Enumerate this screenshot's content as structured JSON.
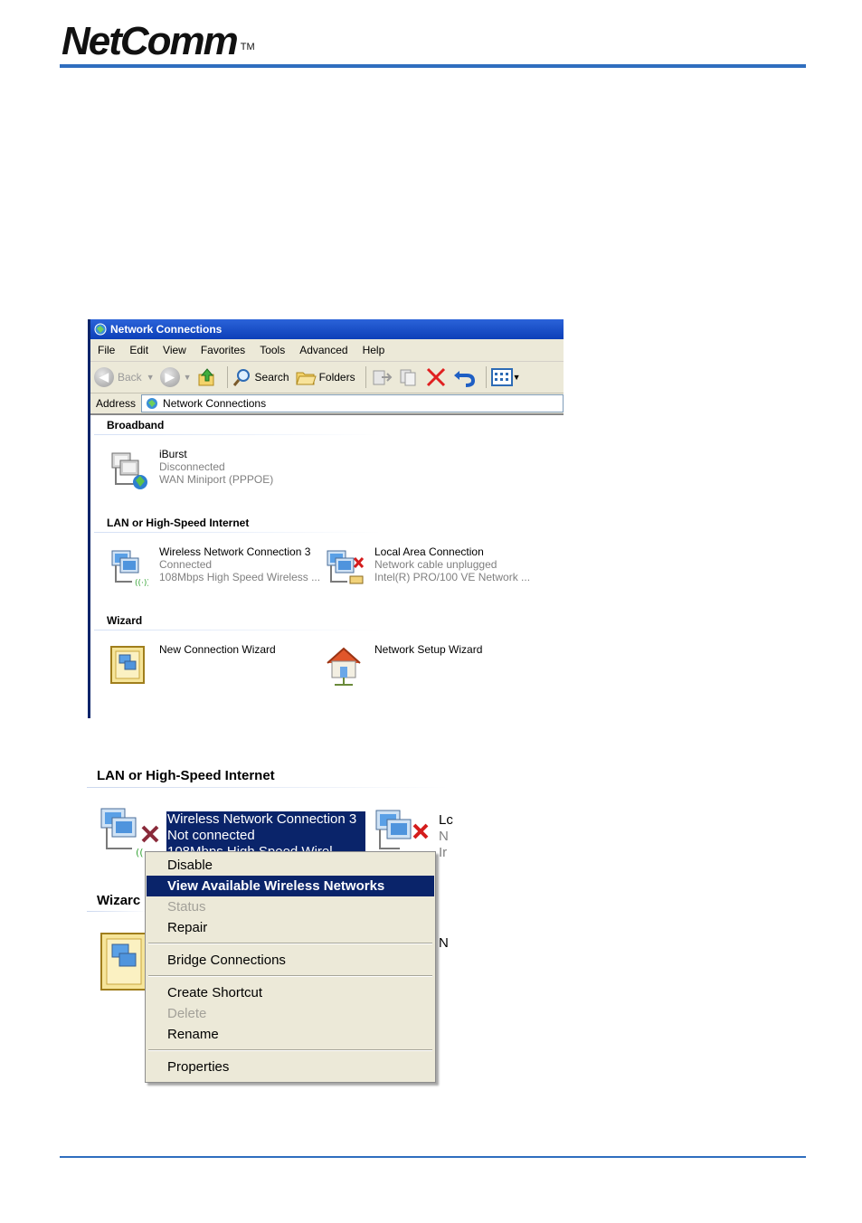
{
  "logo": {
    "text": "NetComm",
    "tm": "TM"
  },
  "window": {
    "title": "Network Connections",
    "menu": [
      "File",
      "Edit",
      "View",
      "Favorites",
      "Tools",
      "Advanced",
      "Help"
    ],
    "toolbar": {
      "back": "Back",
      "search": "Search",
      "folders": "Folders"
    },
    "address": {
      "label": "Address",
      "value": "Network Connections"
    },
    "groups": {
      "broadband": "Broadband",
      "lan": "LAN or High-Speed Internet",
      "wizard": "Wizard"
    },
    "items": {
      "iburst": {
        "name": "iBurst",
        "status": "Disconnected",
        "device": "WAN Miniport (PPPOE)"
      },
      "wireless": {
        "name": "Wireless Network Connection 3",
        "status": "Connected",
        "device": "108Mbps High Speed Wireless ..."
      },
      "local": {
        "name": "Local Area Connection",
        "status": "Network cable unplugged",
        "device": "Intel(R) PRO/100 VE Network ..."
      },
      "newwiz": {
        "name": "New Connection Wizard"
      },
      "setupwiz": {
        "name": "Network Setup Wizard"
      }
    }
  },
  "shot2": {
    "group_lan": "LAN or High-Speed Internet",
    "group_wizard": "Wizarc",
    "selected_name": "Wireless Network Connection 3",
    "selected_status": "Not connected",
    "selected_device": "108Mbps High Speed Wirel",
    "cut_right": [
      "Lc",
      "N",
      "Ir"
    ],
    "cut_n": "N"
  },
  "context_menu": {
    "items": [
      {
        "label": "Disable",
        "state": "normal"
      },
      {
        "label": "View Available Wireless Networks",
        "state": "selected"
      },
      {
        "label": "Status",
        "state": "disabled"
      },
      {
        "label": "Repair",
        "state": "normal"
      },
      {
        "label": "Bridge Connections",
        "state": "normal"
      },
      {
        "label": "Create Shortcut",
        "state": "normal"
      },
      {
        "label": "Delete",
        "state": "disabled"
      },
      {
        "label": "Rename",
        "state": "normal"
      },
      {
        "label": "Properties",
        "state": "normal"
      }
    ]
  },
  "colors": {
    "accent": "#2f6ebf",
    "selection": "#0a246a",
    "menu_bg": "#ece9d8"
  }
}
